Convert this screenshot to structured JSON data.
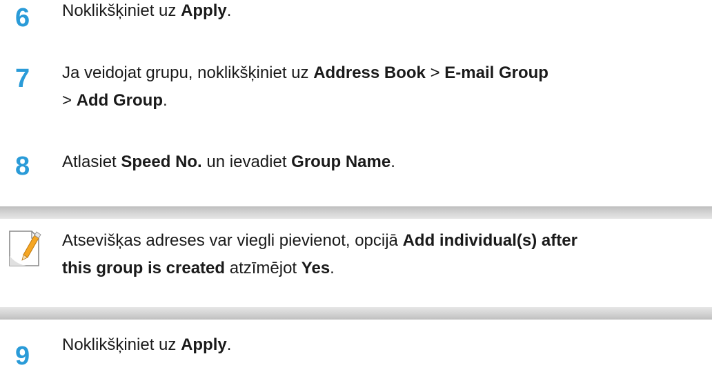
{
  "steps": [
    {
      "number": "6",
      "segments": [
        {
          "text": "Noklikšķiniet uz ",
          "bold": false
        },
        {
          "text": "Apply",
          "bold": true
        },
        {
          "text": ".",
          "bold": false
        }
      ]
    },
    {
      "number": "7",
      "line1": [
        {
          "text": "Ja veidojat grupu, noklikšķiniet uz ",
          "bold": false
        },
        {
          "text": "Address Book",
          "bold": true
        },
        {
          "text": " > ",
          "bold": false
        },
        {
          "text": "E-mail Group",
          "bold": true
        }
      ],
      "line2": [
        {
          "text": "> ",
          "bold": false
        },
        {
          "text": "Add Group",
          "bold": true
        },
        {
          "text": ".",
          "bold": false
        }
      ]
    },
    {
      "number": "8",
      "segments": [
        {
          "text": "Atlasiet ",
          "bold": false
        },
        {
          "text": "Speed No.",
          "bold": true
        },
        {
          "text": " un ievadiet ",
          "bold": false
        },
        {
          "text": "Group Name",
          "bold": true
        },
        {
          "text": ".",
          "bold": false
        }
      ]
    },
    {
      "number": "9",
      "segments": [
        {
          "text": "Noklikšķiniet uz ",
          "bold": false
        },
        {
          "text": "Apply",
          "bold": true
        },
        {
          "text": ".",
          "bold": false
        }
      ]
    }
  ],
  "note": {
    "icon": "note-pencil-icon",
    "line1": [
      {
        "text": "Atsevišķas adreses var viegli pievienot, opcijā ",
        "bold": false
      },
      {
        "text": "Add individual(s) after",
        "bold": true
      }
    ],
    "line2": [
      {
        "text": "this group is created",
        "bold": true
      },
      {
        "text": " atzīmējot ",
        "bold": false
      },
      {
        "text": "Yes",
        "bold": true
      },
      {
        "text": ".",
        "bold": false
      }
    ]
  },
  "colors": {
    "step_number": "#2a9bd8",
    "text": "#1a1a1a",
    "note_bar": "#c8c8c8",
    "pencil": "#f5a623"
  }
}
